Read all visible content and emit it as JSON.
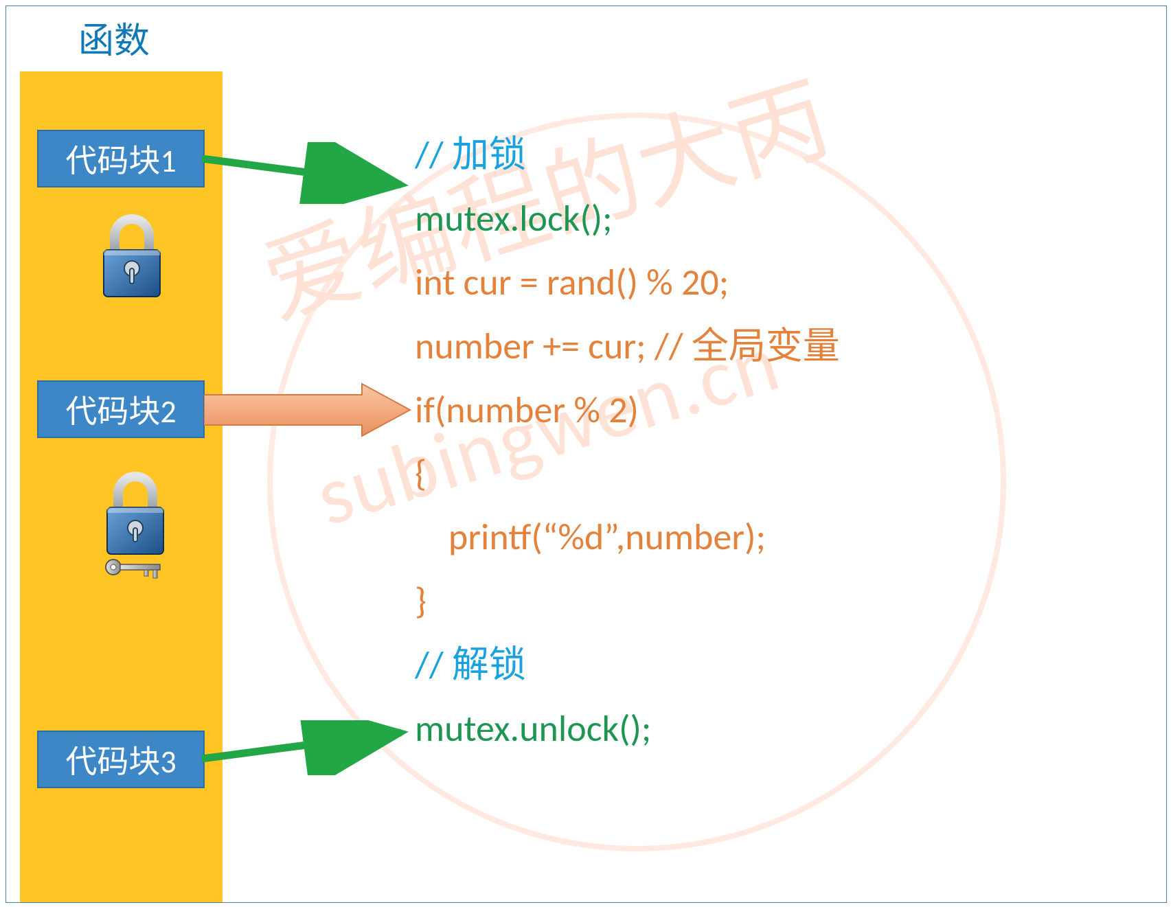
{
  "diagram": {
    "title": "函数",
    "blocks": {
      "b1": "代码块1",
      "b2": "代码块2",
      "b3": "代码块3"
    },
    "icons": {
      "lock1_name": "lock-closed-icon",
      "lock2_name": "lock-with-key-icon"
    },
    "arrows": {
      "a1_name": "arrow-block1-to-code",
      "a2_name": "arrow-block2-to-code",
      "a3_name": "arrow-block3-to-code"
    }
  },
  "code": {
    "c1": "// 加锁",
    "l1": "mutex.lock();",
    "l2": "int cur = rand() % 20;",
    "l3a": "number += cur; ",
    "l3b": "// 全局变量",
    "l4": "if(number % 2)",
    "l5": "{",
    "l6": "    printf(“%d”,number);",
    "l7": "}",
    "c2": "// 解锁",
    "l8": "mutex.unlock();"
  },
  "watermark": {
    "line1": "爱编程的大丙",
    "line2": "subingwen.cn"
  },
  "colors": {
    "column_bg": "#ffc524",
    "box_bg": "#3d87c6",
    "arrow_green": "#23a746",
    "arrow_orange": "#f1a77a",
    "comment": "#1aa1e0",
    "code_green": "#1e9653",
    "code_orange": "#e4813b"
  }
}
